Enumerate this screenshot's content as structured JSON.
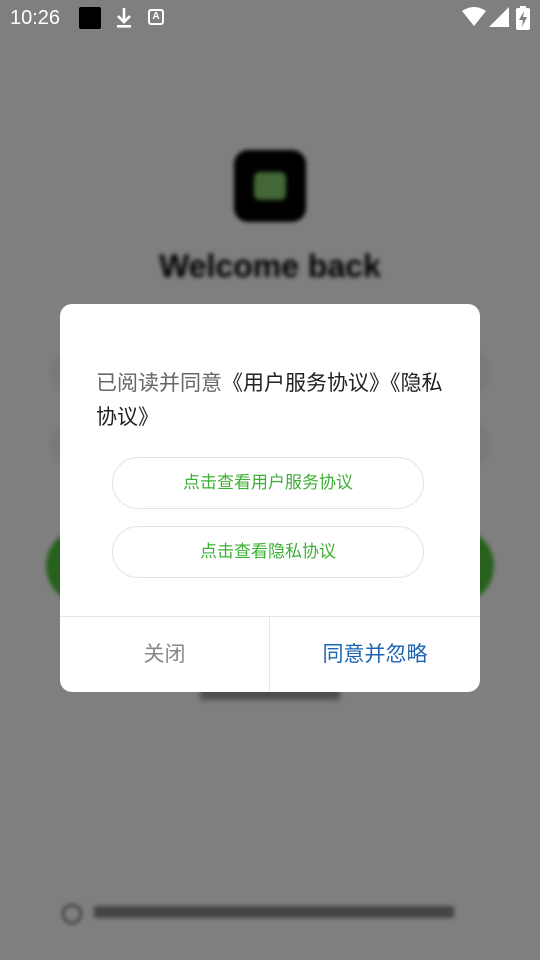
{
  "status_bar": {
    "time": "10:26",
    "icons": [
      "notification-black-square-icon",
      "download-icon",
      "font-a-icon",
      "wifi-icon",
      "signal-icon",
      "battery-charging-icon"
    ],
    "font_glyph": "A"
  },
  "background": {
    "welcome_title": "Welcome back"
  },
  "dialog": {
    "message_plain": "已阅读并同意",
    "message_links": "《用户服务协议》《隐私协议》",
    "view_user_agreement": "点击查看用户服务协议",
    "view_privacy_policy": "点击查看隐私协议",
    "close_label": "关闭",
    "agree_label": "同意并忽略",
    "colors": {
      "link_green": "#3cb034",
      "agree_blue": "#1e64b4",
      "close_gray": "#888888"
    }
  }
}
